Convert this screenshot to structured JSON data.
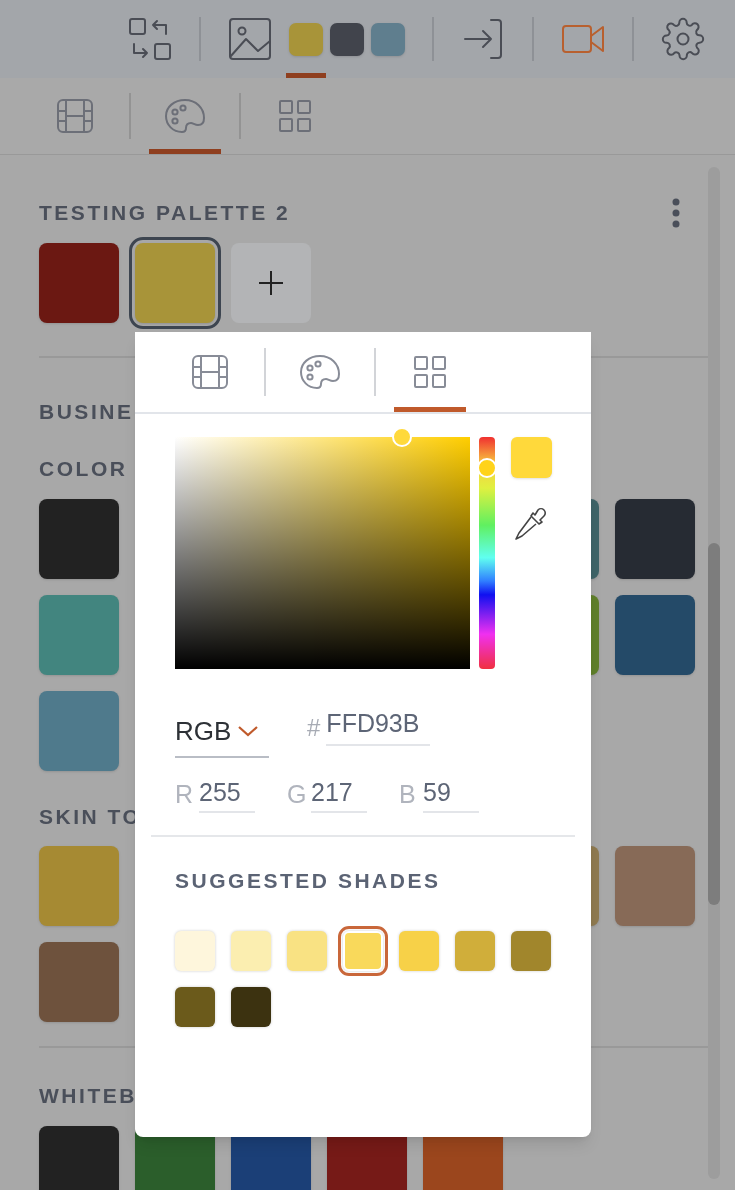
{
  "toolbar": {
    "chips": [
      {
        "color": "#a89439",
        "selected": true
      },
      {
        "color": "#41444c",
        "selected": false
      },
      {
        "color": "#5f7e8e",
        "selected": false
      }
    ]
  },
  "view_tabs": [
    {
      "kind": "film",
      "selected": false
    },
    {
      "kind": "palette",
      "selected": true
    },
    {
      "kind": "grid",
      "selected": false
    }
  ],
  "palette": {
    "title": "TESTING PALETTE 2",
    "swatches": [
      {
        "color": "#6b1812",
        "selected": false
      },
      {
        "color": "#a89439",
        "selected": true
      }
    ]
  },
  "collections": [
    {
      "title_lines": [
        "BUSINE",
        "COLOR"
      ],
      "rows": [
        [
          {
            "color": "#222222"
          },
          null,
          null,
          null,
          null,
          {
            "color": "#3f6468"
          },
          {
            "color": "#262b33"
          }
        ],
        [
          {
            "color": "#42857f"
          },
          null,
          null,
          null,
          null,
          {
            "color": "#5f7f2a"
          },
          {
            "color": "#244a68"
          }
        ],
        [
          {
            "color": "#4f7a8c"
          }
        ]
      ]
    },
    {
      "title_lines": [
        "SKIN TO"
      ],
      "rows": [
        [
          {
            "color": "#a68a33"
          },
          null,
          null,
          null,
          null,
          {
            "color": "#8f7a50"
          },
          {
            "color": "#876a57"
          }
        ],
        [
          {
            "color": "#6e523d"
          }
        ]
      ]
    },
    {
      "title_lines": [
        "WHITEB"
      ],
      "rows": [
        [
          {
            "color": "#222222"
          },
          {
            "color": "#2b5e2b"
          },
          {
            "color": "#1b3f77"
          },
          {
            "color": "#761a17"
          },
          {
            "color": "#9b461d"
          }
        ]
      ]
    }
  ],
  "color_picker": {
    "tabs": [
      {
        "kind": "film",
        "selected": false
      },
      {
        "kind": "palette",
        "selected": false
      },
      {
        "kind": "grid",
        "selected": true
      }
    ],
    "mode": "RGB",
    "hex_prefix": "#",
    "hex": "FFD93B",
    "channels": [
      {
        "label": "R",
        "value": "255"
      },
      {
        "label": "G",
        "value": "217"
      },
      {
        "label": "B",
        "value": "59"
      }
    ],
    "shades_title": "SUGGESTED SHADES",
    "shades": [
      {
        "color": "#fef6dc",
        "selected": false
      },
      {
        "color": "#fbeeb0",
        "selected": false
      },
      {
        "color": "#f9e283",
        "selected": false
      },
      {
        "color": "#f9d95b",
        "selected": true
      },
      {
        "color": "#f7d148",
        "selected": false
      },
      {
        "color": "#d0ae3a",
        "selected": false
      },
      {
        "color": "#a1862c",
        "selected": false
      },
      {
        "color": "#6b5a1b",
        "selected": false
      },
      {
        "color": "#3c3210",
        "selected": false
      }
    ]
  }
}
